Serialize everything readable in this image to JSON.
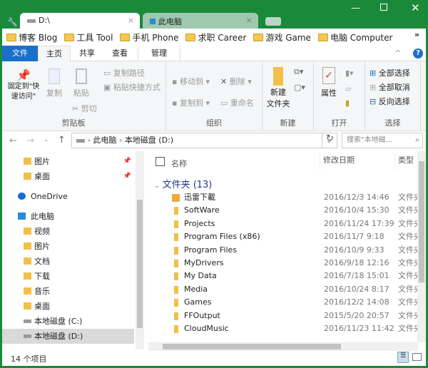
{
  "window": {
    "tabs": [
      {
        "label": "D:\\"
      },
      {
        "label": "此电脑"
      }
    ],
    "controls": [
      "minimize",
      "maximize",
      "close"
    ]
  },
  "bookmarks": [
    "博客 Blog",
    "工具 Tool",
    "手机 Phone",
    "求职 Career",
    "游戏 Game",
    "电脑 Computer"
  ],
  "bookmarks_more": "»",
  "ribbon": {
    "tabs": [
      "文件",
      "主页",
      "共享",
      "查看",
      "管理"
    ],
    "clipboard": {
      "pin": "固定到\"快速访问\"",
      "copy": "复制",
      "paste": "粘贴",
      "copy_path": "复制路径",
      "paste_shortcut": "粘贴快捷方式",
      "cut": "剪切",
      "label": "剪贴板"
    },
    "organize": {
      "move_to": "移动到",
      "copy_to": "复制到",
      "delete": "删除",
      "rename": "重命名",
      "label": "组织"
    },
    "new": {
      "new_folder": "新建\n文件夹",
      "label": "新建"
    },
    "open": {
      "properties": "属性",
      "label": "打开"
    },
    "select": {
      "select_all": "全部选择",
      "select_none": "全部取消",
      "invert": "反向选择",
      "label": "选择"
    }
  },
  "address": {
    "path": [
      "此电脑",
      "本地磁盘 (D:)"
    ],
    "search_placeholder": "搜索\"本地磁..."
  },
  "nav": {
    "items": [
      {
        "label": "图片",
        "pinned": true
      },
      {
        "label": "桌面",
        "pinned": true
      },
      {
        "label": "OneDrive"
      },
      {
        "label": "此电脑"
      },
      {
        "label": "视频"
      },
      {
        "label": "图片"
      },
      {
        "label": "文档"
      },
      {
        "label": "下载"
      },
      {
        "label": "音乐"
      },
      {
        "label": "桌面"
      },
      {
        "label": "本地磁盘 (C:)"
      },
      {
        "label": "本地磁盘 (D:)",
        "selected": true
      }
    ]
  },
  "columns": {
    "name": "名称",
    "date": "修改日期",
    "type": "类型"
  },
  "group": "文件夹 (13)",
  "files": [
    {
      "name": "迅雷下載",
      "date": "2016/12/3 14:46",
      "type": "文件夹"
    },
    {
      "name": "SoftWare",
      "date": "2016/10/4 15:30",
      "type": "文件夹"
    },
    {
      "name": "Projects",
      "date": "2016/11/24 17:39",
      "type": "文件夹"
    },
    {
      "name": "Program Files (x86)",
      "date": "2016/11/7 9:18",
      "type": "文件夹"
    },
    {
      "name": "Program Files",
      "date": "2016/10/9 9:33",
      "type": "文件夹"
    },
    {
      "name": "MyDrivers",
      "date": "2016/9/18 12:16",
      "type": "文件夹"
    },
    {
      "name": "My Data",
      "date": "2016/7/18 15:01",
      "type": "文件夹"
    },
    {
      "name": "Media",
      "date": "2016/10/24 8:17",
      "type": "文件夹"
    },
    {
      "name": "Games",
      "date": "2016/12/2 14:08",
      "type": "文件夹"
    },
    {
      "name": "FFOutput",
      "date": "2015/5/20 20:57",
      "type": "文件夹"
    },
    {
      "name": "CloudMusic",
      "date": "2016/11/23 11:42",
      "type": "文件夹"
    }
  ],
  "status": "14 个项目",
  "colors": {
    "frame": "#1a8a3a",
    "accent": "#1a6fc9"
  }
}
